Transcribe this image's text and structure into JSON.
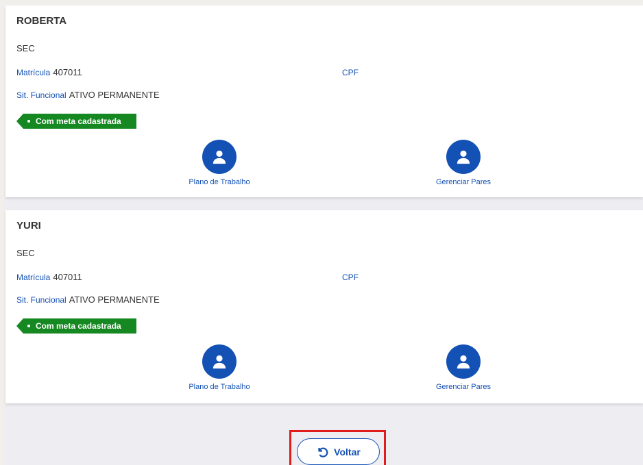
{
  "employees": [
    {
      "name": "ROBERTA",
      "org": "SEC",
      "matricula_label": "Matrícula",
      "matricula_value": "407011",
      "cpf_label": "CPF",
      "sit_label": "Sit. Funcional",
      "sit_value": "ATIVO PERMANENTE",
      "badge": "Com meta cadastrada",
      "plano_label": "Plano de Trabalho",
      "pares_label": "Gerenciar Pares"
    },
    {
      "name": "YURI",
      "org": "SEC",
      "matricula_label": "Matrícula",
      "matricula_value": "407011",
      "cpf_label": "CPF",
      "sit_label": "Sit. Funcional",
      "sit_value": "ATIVO PERMANENTE",
      "badge": "Com meta cadastrada",
      "plano_label": "Plano de Trabalho",
      "pares_label": "Gerenciar Pares"
    }
  ],
  "footer": {
    "voltar_label": "Voltar"
  },
  "colors": {
    "primary": "#1451b4",
    "success": "#168821",
    "highlight": "#e01b1b"
  },
  "icons": {
    "user": "user-icon",
    "back": "undo-icon"
  }
}
